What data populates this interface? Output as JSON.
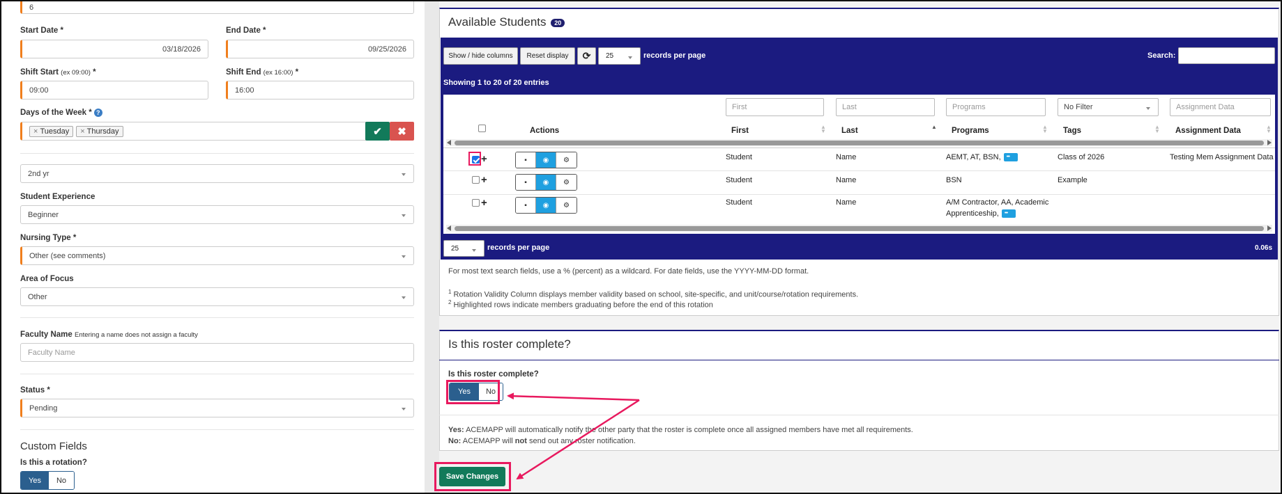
{
  "form": {
    "top_value": "6",
    "start_date": {
      "label": "Start Date *",
      "value": "03/18/2026"
    },
    "end_date": {
      "label": "End Date *",
      "value": "09/25/2026"
    },
    "shift_start": {
      "label": "Shift Start",
      "hint": "(ex 09:00)",
      "star": "*",
      "value": "09:00"
    },
    "shift_end": {
      "label": "Shift End",
      "hint": "(ex 16:00)",
      "star": "*",
      "value": "16:00"
    },
    "days": {
      "label": "Days of the Week *",
      "help": "?",
      "tags": [
        "Tuesday",
        "Thursday"
      ],
      "remove_glyph": "×"
    },
    "year_select": "2nd yr",
    "experience": {
      "label": "Student Experience",
      "value": "Beginner"
    },
    "nursing_type": {
      "label": "Nursing Type *",
      "value": "Other (see comments)"
    },
    "area_focus": {
      "label": "Area of Focus",
      "value": "Other"
    },
    "faculty": {
      "label": "Faculty Name",
      "hint": "Entering a name does not assign a faculty",
      "placeholder": "Faculty Name"
    },
    "status": {
      "label": "Status *",
      "value": "Pending"
    },
    "custom_fields_title": "Custom Fields",
    "rotation": {
      "label": "Is this a rotation?",
      "yes": "Yes",
      "no": "No"
    }
  },
  "students": {
    "title": "Available Students",
    "count": "20",
    "toolbar": {
      "show_hide": "Show / hide columns",
      "reset": "Reset display",
      "per_page": "25",
      "per_page_label": "records per page",
      "search_label": "Search:"
    },
    "showing": "Showing 1 to 20 of 20 entries",
    "filters": {
      "first": "First",
      "last": "Last",
      "programs": "Programs",
      "tags": "No Filter",
      "assignment": "Assignment Data"
    },
    "columns": {
      "actions": "Actions",
      "first": "First",
      "last": "Last",
      "programs": "Programs",
      "tags": "Tags",
      "assignment": "Assignment Data"
    },
    "rows": [
      {
        "first": "Student",
        "last": "Name",
        "programs": "AEMT, AT, BSN,",
        "tags": "Class of 2026",
        "assignment": "Testing Mem Assignment Data",
        "checked": true
      },
      {
        "first": "Student",
        "last": "Name",
        "programs": "BSN",
        "tags": "Example",
        "assignment": "",
        "checked": false
      },
      {
        "first": "Student",
        "last": "Name",
        "programs": "A/M Contractor, AA, Academic",
        "programs2": "Apprenticeship,",
        "tags": "",
        "assignment": "",
        "checked": false
      }
    ],
    "footer_per_page": "25",
    "footer_per_page_label": "records per page",
    "timing": "0.06s",
    "note1": "For most text search fields, use a % (percent) as a wildcard. For date fields, use the YYYY-MM-DD format.",
    "footnote1_num": "1",
    "footnote1": "Rotation Validity Column displays member validity based on school, site-specific, and unit/course/rotation requirements.",
    "footnote2_num": "2",
    "footnote2": "Highlighted rows indicate members graduating before the end of this rotation"
  },
  "roster": {
    "title": "Is this roster complete?",
    "question": "Is this roster complete?",
    "yes": "Yes",
    "no": "No",
    "yes_label": "Yes:",
    "yes_text": "ACEMAPP will automatically notify the other party that the roster is complete once all assigned members have met all requirements.",
    "no_label": "No:",
    "no_text_a": "ACEMAPP will",
    "no_text_b": "not",
    "no_text_c": "send out any roster notification."
  },
  "save_label": "Save Changes",
  "colors": {
    "accent": "#1b1b80",
    "highlight": "#e8195e",
    "save": "#127a5a",
    "required": "#f07f1d"
  }
}
